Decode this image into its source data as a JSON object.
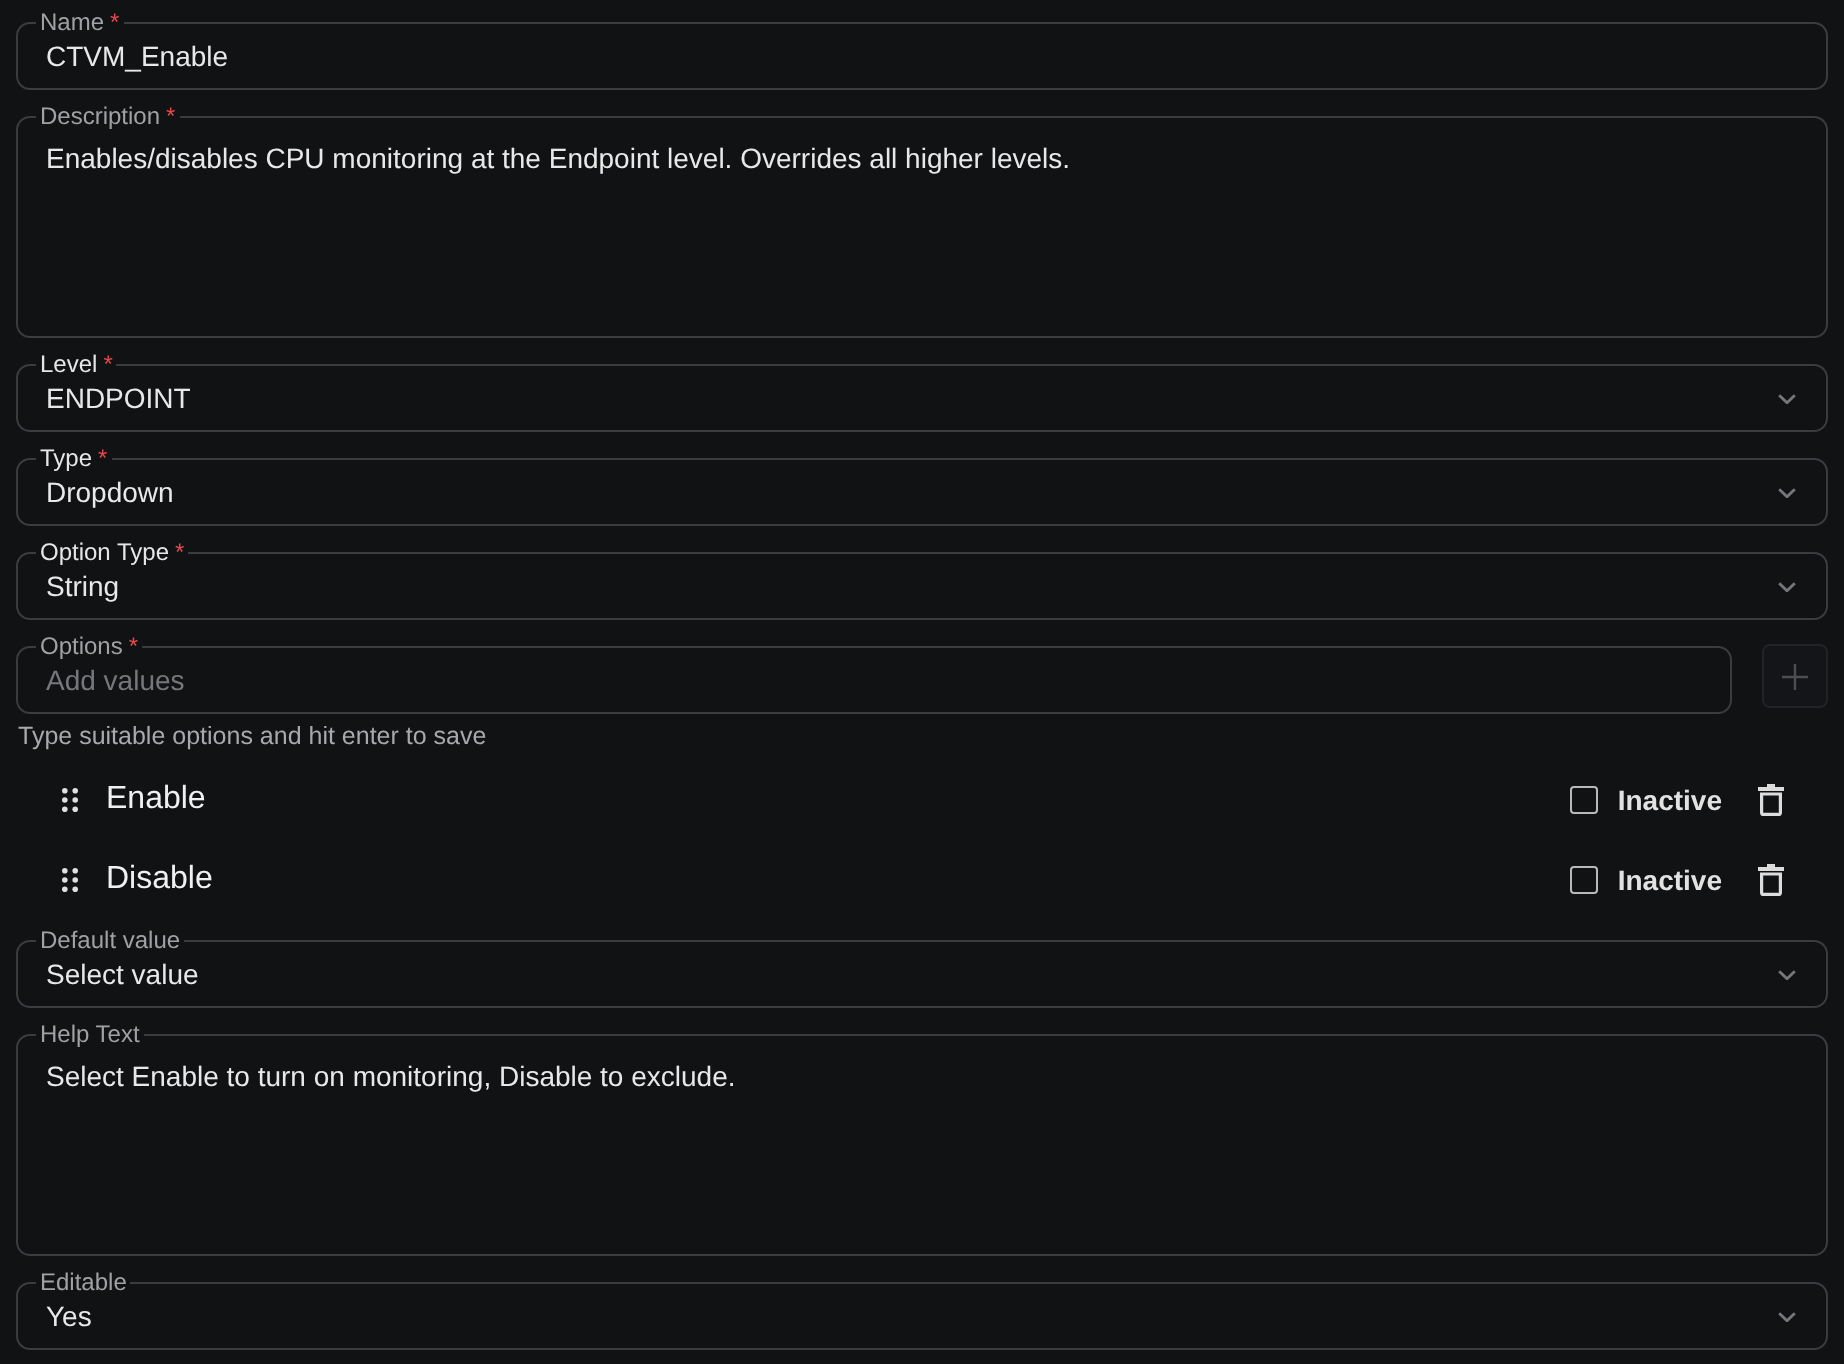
{
  "fields": [
    {
      "kind": "text",
      "label": "Name",
      "required_mark": "*",
      "label_highlighted": false,
      "value": "CTVM_Enable"
    },
    {
      "kind": "textarea",
      "label": "Description",
      "required_mark": "*",
      "label_highlighted": false,
      "value": "Enables/disables CPU monitoring at the Endpoint level. Overrides all higher levels."
    },
    {
      "kind": "select",
      "label": "Level",
      "required_mark": "*",
      "label_highlighted": true,
      "value": "ENDPOINT"
    },
    {
      "kind": "select",
      "label": "Type",
      "required_mark": "*",
      "label_highlighted": true,
      "value": "Dropdown"
    },
    {
      "kind": "select",
      "label": "Option Type",
      "required_mark": "*",
      "label_highlighted": true,
      "value": "String"
    },
    {
      "kind": "tags",
      "label": "Options",
      "required_mark": "*",
      "label_highlighted": false,
      "placeholder": "Add values",
      "hint": "Type suitable options and hit enter to save",
      "options": [
        {
          "label": "Enable",
          "checkbox_label": "Inactive",
          "checked": false
        },
        {
          "label": "Disable",
          "checkbox_label": "Inactive",
          "checked": false
        }
      ]
    },
    {
      "kind": "select",
      "label": "Default value",
      "label_highlighted": false,
      "value": "Select value"
    },
    {
      "kind": "textarea",
      "label": "Help Text",
      "label_highlighted": false,
      "value": "Select Enable to turn on monitoring, Disable to exclude."
    },
    {
      "kind": "select",
      "label": "Editable",
      "label_highlighted": false,
      "value": "Yes"
    }
  ]
}
